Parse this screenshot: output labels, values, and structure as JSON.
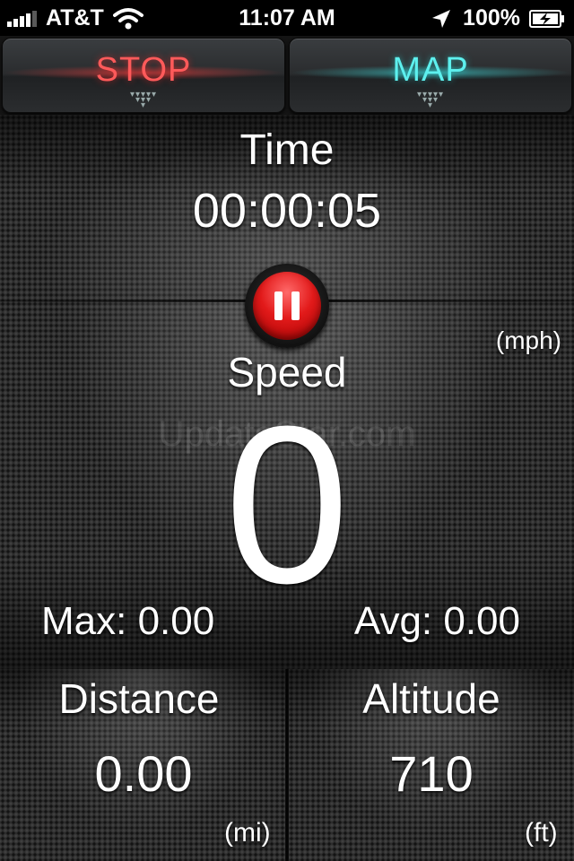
{
  "status_bar": {
    "carrier": "AT&T",
    "time": "11:07 AM",
    "battery_percent": "100%",
    "icons": [
      "signal-bars-icon",
      "wifi-icon",
      "location-arrow-icon",
      "battery-charging-icon"
    ]
  },
  "controls": {
    "stop_label": "STOP",
    "map_label": "MAP",
    "stop_color": "#ff5a5a",
    "map_color": "#5df0ee"
  },
  "time": {
    "label": "Time",
    "value": "00:00:05"
  },
  "pause": {
    "icon": "pause-icon",
    "color": "#e21a1a"
  },
  "speed": {
    "label": "Speed",
    "unit": "(mph)",
    "value": "0",
    "max": "Max: 0.00",
    "avg": "Avg: 0.00",
    "watermark": "UpdateStar.com"
  },
  "distance": {
    "label": "Distance",
    "value": "0.00",
    "unit": "(mi)"
  },
  "altitude": {
    "label": "Altitude",
    "value": "710",
    "unit": "(ft)"
  }
}
